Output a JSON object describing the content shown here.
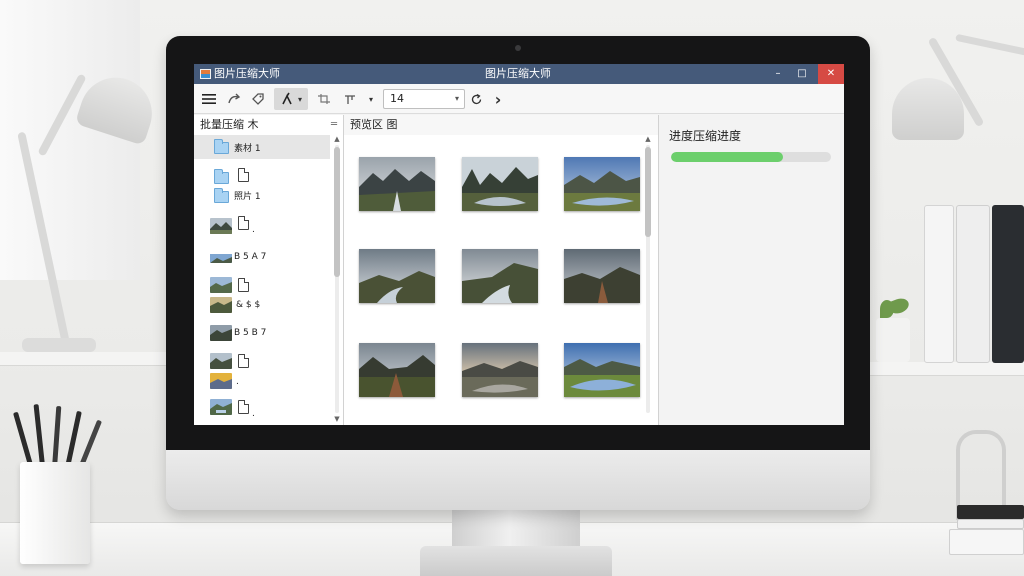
{
  "window": {
    "title": "图片压缩大师",
    "minimize": "–",
    "maximize": "□",
    "close": "✕"
  },
  "toolbar": {
    "zoom_value": "14",
    "zoom_caret": "▾",
    "caret": "▾",
    "next": "›"
  },
  "left_panel": {
    "title": "批量压缩 木",
    "menu": "═",
    "items": [
      {
        "label": "素材 1"
      },
      {
        "label": "照片 1"
      },
      {
        "label": "."
      },
      {
        "label": "B 5 A 7"
      },
      {
        "label": "& $ $"
      },
      {
        "label": "B 5 B 7"
      },
      {
        "label": "."
      },
      {
        "label": "."
      },
      {
        "label": ""
      }
    ]
  },
  "center_panel": {
    "title": "预览区 图"
  },
  "right_panel": {
    "title": "进度压缩进度",
    "progress_fraction": 0.7
  },
  "colors": {
    "titlebar": "#455a7a",
    "close": "#d64a44",
    "progress": "#6ccf6c"
  }
}
